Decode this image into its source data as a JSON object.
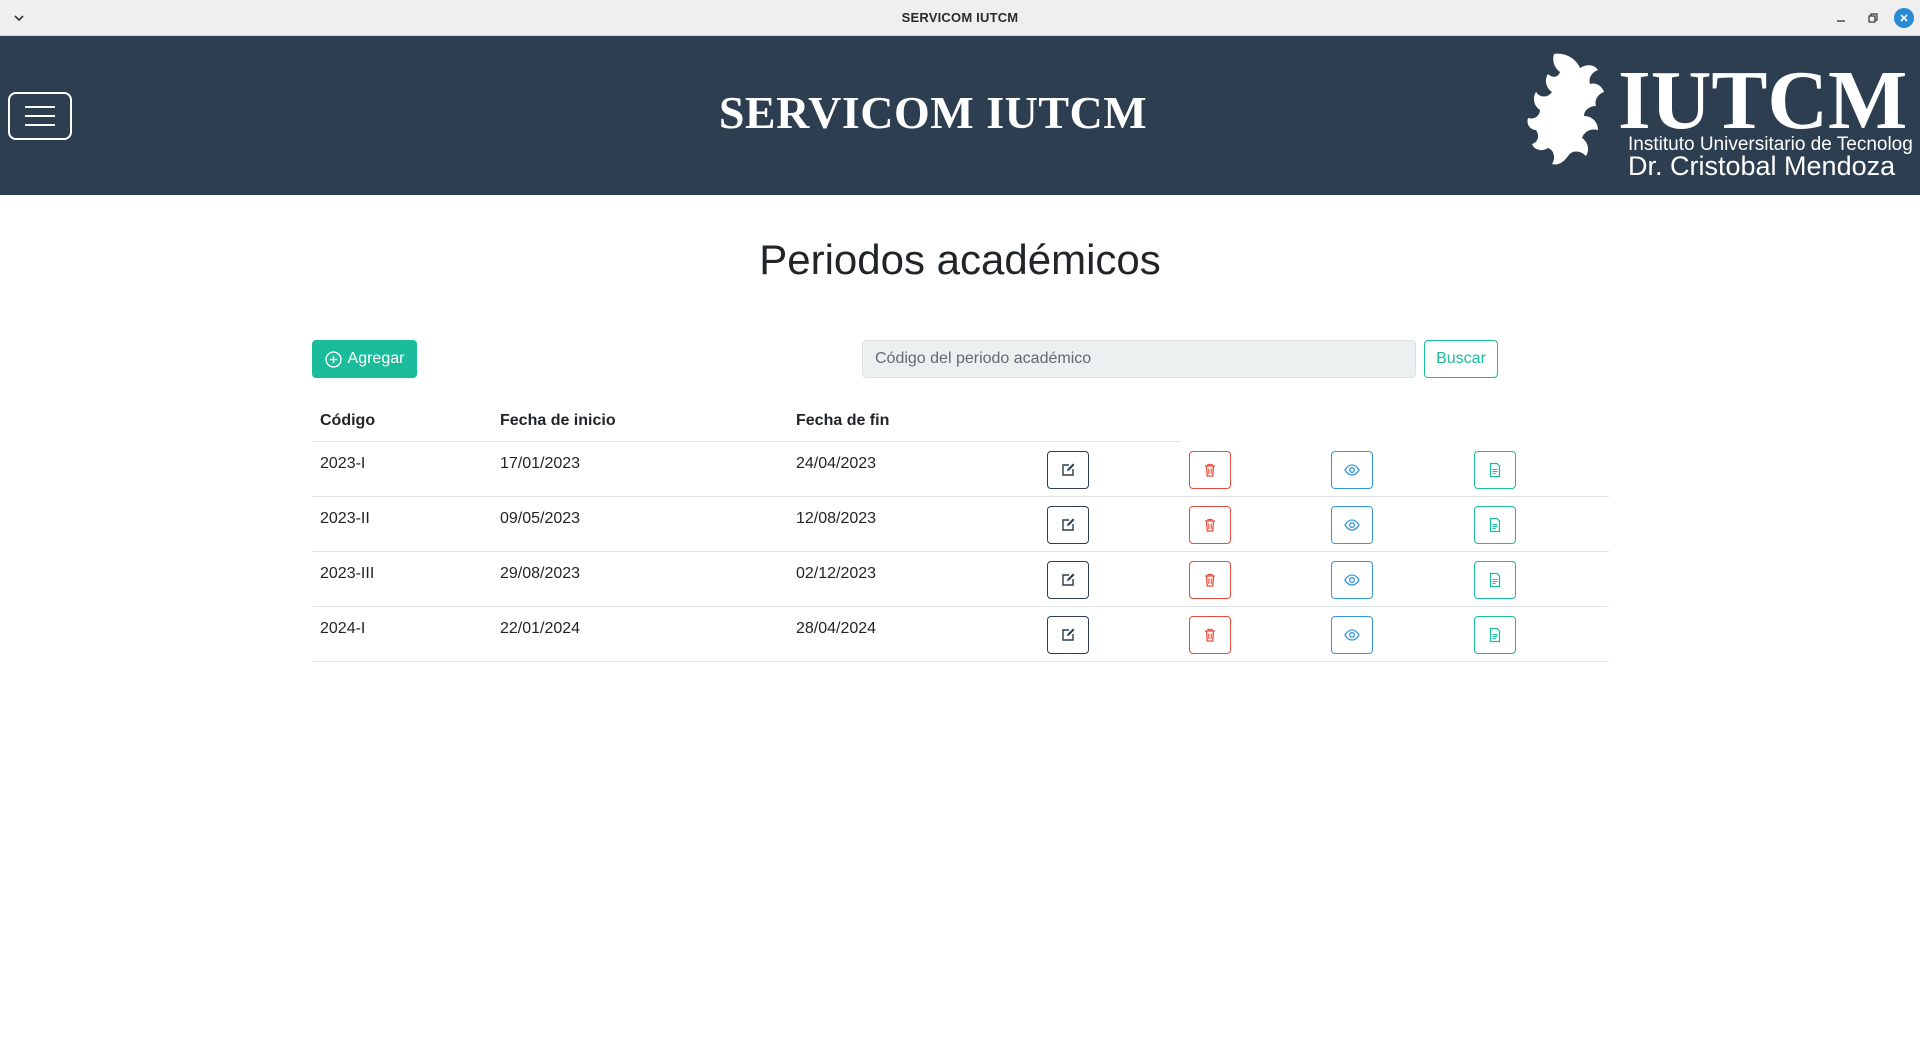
{
  "window": {
    "title": "SERVICOM IUTCM"
  },
  "header": {
    "brand": "SERVICOM IUTCM",
    "logo": {
      "mark": "IUTCM",
      "line1": "Instituto Universitario de Tecnología",
      "line2": "Dr. Cristobal Mendoza"
    }
  },
  "main": {
    "title": "Periodos académicos",
    "add_label": "Agregar",
    "search": {
      "placeholder": "Código del periodo académico",
      "value": "",
      "button": "Buscar"
    },
    "table": {
      "columns": [
        "Código",
        "Fecha de inicio",
        "Fecha de fin"
      ],
      "rows": [
        {
          "code": "2023-I",
          "start": "17/01/2023",
          "end": "24/04/2023"
        },
        {
          "code": "2023-II",
          "start": "09/05/2023",
          "end": "12/08/2023"
        },
        {
          "code": "2023-III",
          "start": "29/08/2023",
          "end": "02/12/2023"
        },
        {
          "code": "2024-I",
          "start": "22/01/2024",
          "end": "28/04/2024"
        }
      ],
      "row_actions": [
        "edit-icon",
        "trash-icon",
        "eye-icon",
        "document-icon"
      ]
    }
  },
  "colors": {
    "header_bg": "#2c3e50",
    "accent": "#1abc9c",
    "danger": "#e74c3c",
    "info": "#3498db",
    "dark": "#2c3e50"
  }
}
